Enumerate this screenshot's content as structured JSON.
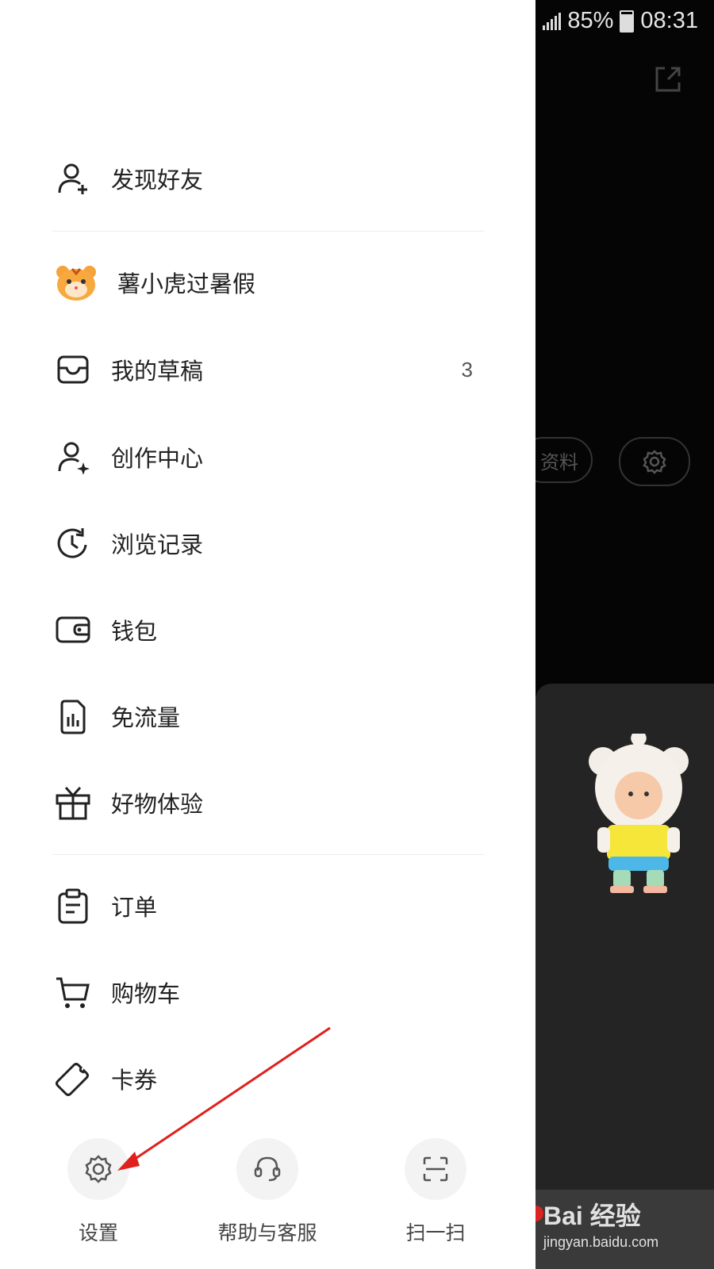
{
  "status_bar": {
    "battery": "85%",
    "time": "08:31"
  },
  "menu": {
    "discover_friends": "发现好友",
    "promo": "薯小虎过暑假",
    "drafts": {
      "label": "我的草稿",
      "count": "3"
    },
    "creator_center": "创作中心",
    "history": "浏览记录",
    "wallet": "钱包",
    "free_data": "免流量",
    "product_trial": "好物体验",
    "orders": "订单",
    "cart": "购物车",
    "coupons": "卡券"
  },
  "bottom_actions": {
    "settings": "设置",
    "help": "帮助与客服",
    "scan": "扫一扫"
  },
  "background": {
    "edit_profile_partial": "资料"
  },
  "watermark": {
    "brand": "Bai 经验",
    "url": "jingyan.baidu.com"
  },
  "colors": {
    "annotation_arrow": "#e0201c",
    "drawer_bg": "#ffffff",
    "icon_circle": "#f3f3f3"
  }
}
